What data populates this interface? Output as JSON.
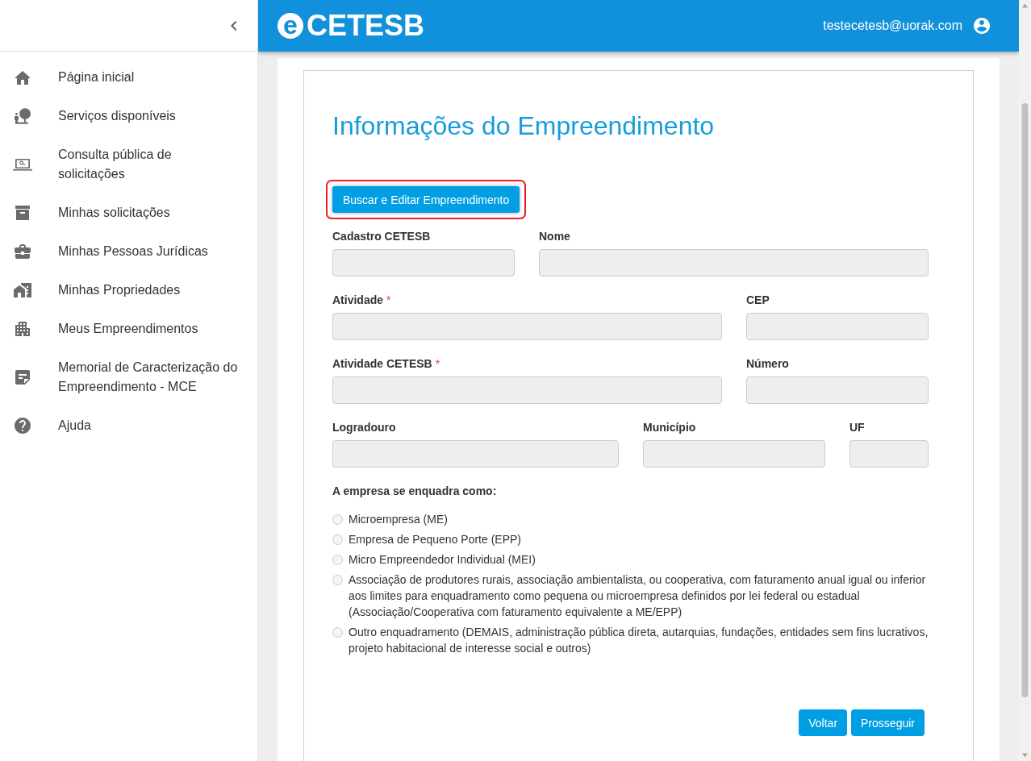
{
  "sidebar": {
    "items": [
      {
        "label": "Página inicial"
      },
      {
        "label": "Serviços disponíveis"
      },
      {
        "label": "Consulta pública de solicitações"
      },
      {
        "label": "Minhas solicitações"
      },
      {
        "label": "Minhas Pessoas Jurídicas"
      },
      {
        "label": "Minhas Propriedades"
      },
      {
        "label": "Meus Empreendimentos"
      },
      {
        "label": "Memorial de Caracterização do Empreendimento - MCE"
      },
      {
        "label": "Ajuda"
      }
    ]
  },
  "header": {
    "logo": {
      "mark": "e",
      "text": "CETESB"
    },
    "user_email": "testecetesb@uorak.com"
  },
  "form": {
    "title": "Informações do Empreendimento",
    "search_button": {
      "label": "Buscar e Editar Empreendimento",
      "highlighted": true
    },
    "rows": [
      [
        {
          "label": "Cadastro CETESB",
          "disabled": true
        },
        {
          "label": "Nome",
          "disabled": true
        }
      ],
      [
        {
          "label": "Atividade",
          "required_mark": "*",
          "disabled": true
        },
        {
          "label": "CEP",
          "disabled": true
        }
      ],
      [
        {
          "label": "Atividade CETESB",
          "required_mark": "*",
          "disabled": true
        },
        {
          "label": "Número",
          "disabled": true
        }
      ],
      [
        {
          "label": "Logradouro",
          "disabled": true
        },
        {
          "label": "Município",
          "disabled": true
        },
        {
          "label": "UF",
          "disabled": true
        }
      ]
    ],
    "company_type": {
      "label": "A empresa se enquadra como:",
      "options": [
        {
          "label": "Microempresa (ME)",
          "selected": false
        },
        {
          "label": "Empresa de Pequeno Porte (EPP)",
          "selected": false
        },
        {
          "label": "Micro Empreendedor Individual (MEI)",
          "selected": false
        },
        {
          "label": "Associação de produtores rurais, associação ambientalista, ou cooperativa, com faturamento anual igual ou inferior aos limites para enquadramento como pequena ou microempresa definidos por lei federal ou estadual (Associação/Cooperativa com faturamento equivalente a ME/EPP)",
          "selected": false
        },
        {
          "label": "Outro enquadramento (DEMAIS, administração pública direta, autarquias, fundações, entidades sem fins lucrativos, projeto habitacional de interesse social e outros)",
          "selected": false
        }
      ]
    },
    "buttons": [
      {
        "label": "Voltar"
      },
      {
        "label": "Prosseguir"
      }
    ]
  }
}
